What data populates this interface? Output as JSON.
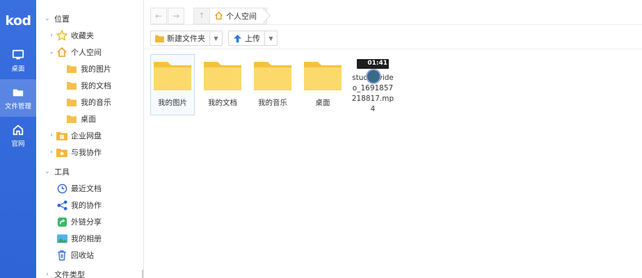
{
  "brand": {
    "logo": "kod",
    "accent": "#3a6fe0"
  },
  "rail": [
    {
      "icon": "desktop-icon",
      "label": "桌面"
    },
    {
      "icon": "folder-icon",
      "label": "文件管理",
      "active": true
    },
    {
      "icon": "home-icon",
      "label": "官网"
    }
  ],
  "tree": {
    "location": "位置",
    "favorites": "收藏夹",
    "personal": "个人空间",
    "pictures": "我的图片",
    "documents": "我的文档",
    "music": "我的音乐",
    "desktop": "桌面",
    "enterprise": "企业网盘",
    "shared": "与我协作",
    "tools": "工具",
    "recent": "最近文档",
    "collab": "我的协作",
    "link_share": "外链分享",
    "album": "我的相册",
    "recycle": "回收站",
    "file_types": "文件类型"
  },
  "address": {
    "back": "←",
    "forward": "→",
    "up": "↑",
    "crumb": "个人空间"
  },
  "toolbar": {
    "new_folder": "新建文件夹",
    "upload": "上传"
  },
  "files": [
    {
      "name": "我的图片",
      "type": "folder",
      "selected": true
    },
    {
      "name": "我的文档",
      "type": "folder"
    },
    {
      "name": "我的音乐",
      "type": "folder"
    },
    {
      "name": "桌面",
      "type": "folder"
    },
    {
      "name": "studio_video_1691857218817.mp4",
      "type": "video",
      "duration": "01:41"
    }
  ]
}
